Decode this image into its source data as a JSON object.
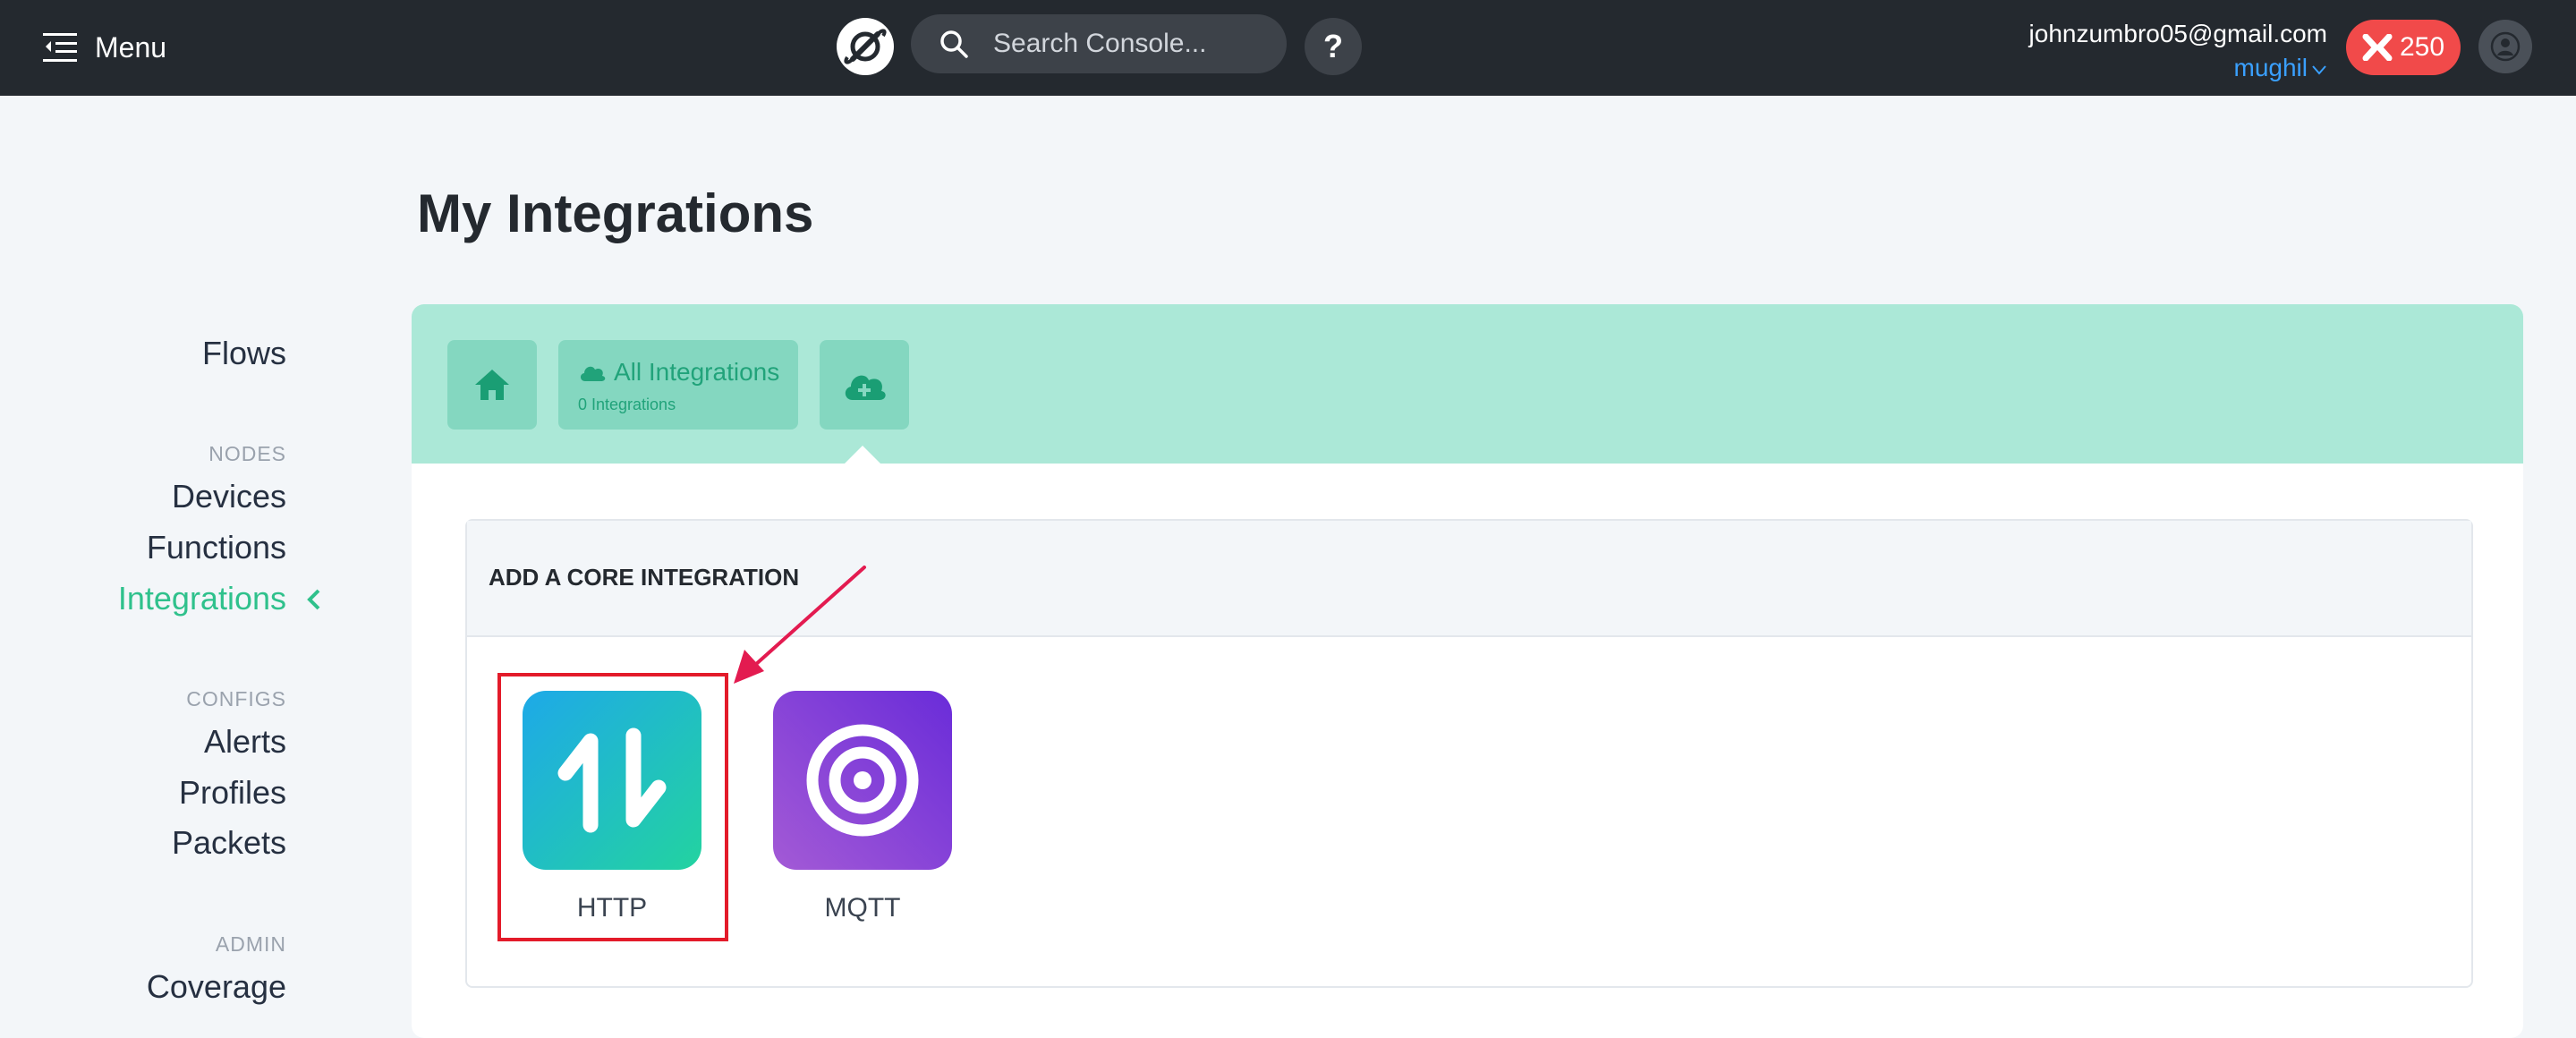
{
  "topbar": {
    "menu_label": "Menu",
    "search_placeholder": "Search Console...",
    "help_label": "?",
    "user_email": "johnzumbro05@gmail.com",
    "org_name": "mughil",
    "credits": "250"
  },
  "sidebar": {
    "items": [
      {
        "label": "Flows"
      },
      {
        "section": "NODES"
      },
      {
        "label": "Devices"
      },
      {
        "label": "Functions"
      },
      {
        "label": "Integrations",
        "active": true
      },
      {
        "section": "CONFIGS"
      },
      {
        "label": "Alerts"
      },
      {
        "label": "Profiles"
      },
      {
        "label": "Packets"
      },
      {
        "section": "ADMIN"
      },
      {
        "label": "Coverage"
      }
    ]
  },
  "main": {
    "title": "My Integrations",
    "tabs": {
      "all_label": "All Integrations",
      "all_count": "0 Integrations"
    },
    "core": {
      "title": "ADD A CORE INTEGRATION",
      "integrations": [
        {
          "name": "HTTP",
          "icon": "up-down-arrows-icon",
          "highlighted": true
        },
        {
          "name": "MQTT",
          "icon": "target-icon",
          "highlighted": false
        }
      ]
    }
  },
  "colors": {
    "topbar": "#24292f",
    "accent_green": "#2fc18c",
    "panel_header": "#abe8d7",
    "credits_badge": "#f14a4a",
    "highlight": "#e31b2a"
  }
}
